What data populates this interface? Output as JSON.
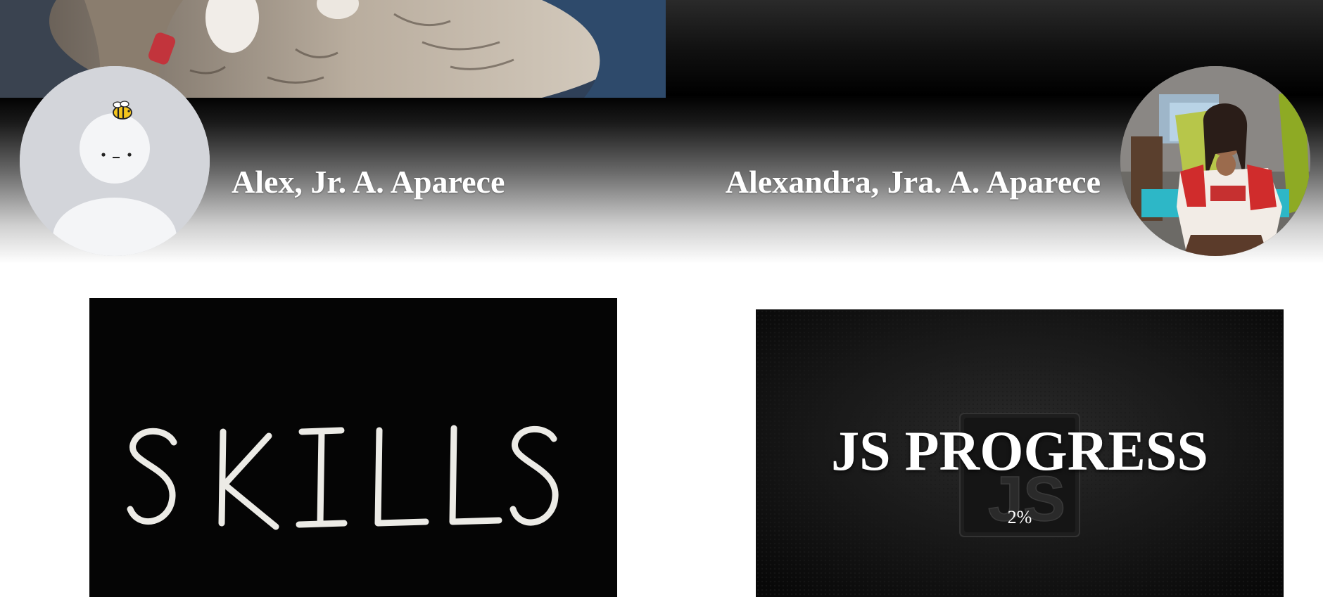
{
  "profile": {
    "left_name": "Alex, Jr. A. Aparece",
    "right_name": "Alexandra, Jra. A. Aparece"
  },
  "cards": {
    "skills": {
      "label": "SKILLS"
    },
    "js_progress": {
      "title": "JS PROGRESS",
      "percent": "2%",
      "value": 0.02,
      "watermark": "JS"
    }
  },
  "icons": {
    "bee": "bee-icon"
  },
  "colors": {
    "header_dark": "#000000",
    "name_text": "#ffffff",
    "avatar_left_bg": "#d3d5da"
  }
}
